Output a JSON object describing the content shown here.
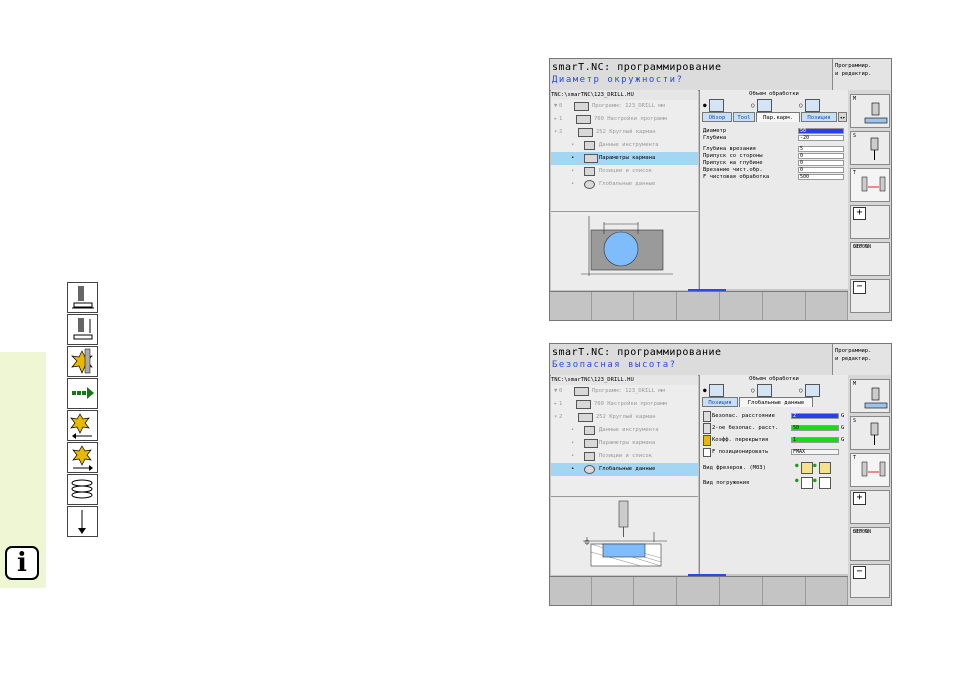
{
  "info_button": {
    "label": "i"
  },
  "left_cycle_icons": [
    "drill-depth-icon",
    "tool-length-icon",
    "rotating-milling-icon",
    "rapid-feed-arrow-icon",
    "milling-cycle-icon",
    "back-milling-icon",
    "helix-icon",
    "straight-arrow-icon"
  ],
  "screen1": {
    "title": "smarT.NC: программирование",
    "subtitle": "Диаметр окружности?",
    "mode": [
      "Программир.",
      "и редактир."
    ],
    "path": "TNC:\\smarTNC\\123_DRILL.HU",
    "tree": [
      {
        "mark": "▼",
        "num": "0",
        "label": "Программ: 123_DRILL мм",
        "selected": false
      },
      {
        "mark": "▸",
        "num": "1",
        "label": "700 Настройки программ",
        "selected": false
      },
      {
        "mark": "▾",
        "num": "2",
        "label": "252 Круглый карман",
        "selected": false
      },
      {
        "mark": "•",
        "num": "",
        "label": "Данные инструмента",
        "selected": false
      },
      {
        "mark": "•",
        "num": "",
        "label": "Параметры кармана",
        "selected": true
      },
      {
        "mark": "•",
        "num": "",
        "label": "Позиции и список",
        "selected": false
      },
      {
        "mark": "•",
        "num": "",
        "label": "Глобальные данные",
        "selected": false
      }
    ],
    "section_title": "Объем обработки",
    "tabs": [
      "Обзор",
      "Tool",
      "Пар.карм.",
      "Позиция"
    ],
    "active_tab": 2,
    "fields": [
      {
        "label": "Диаметр",
        "value": "50",
        "highlight": true
      },
      {
        "label": "Глубина",
        "value": "-20",
        "highlight": false
      },
      {
        "label": "Глубина врезания",
        "value": "5",
        "highlight": false
      },
      {
        "label": "Припуск со стороны",
        "value": "0",
        "highlight": false
      },
      {
        "label": "Припуск на глубине",
        "value": "0",
        "highlight": false
      },
      {
        "label": "Врезание чист.обр.",
        "value": "0",
        "highlight": false
      },
      {
        "label": "F чистовая обработка",
        "value": "500",
        "highlight": false
      }
    ],
    "colors": {
      "highlight": "#2540ee",
      "selected_row": "#a3d6f2",
      "accent": "#2a4be0"
    }
  },
  "screen2": {
    "title": "smarT.NC: программирование",
    "subtitle": "Безопасная высота?",
    "mode": [
      "Программир.",
      "и редактир."
    ],
    "path": "TNC:\\smarTNC\\123_DRILL.HU",
    "tree": [
      {
        "mark": "▼",
        "num": "0",
        "label": "Программ: 123_DRILL мм",
        "selected": false
      },
      {
        "mark": "▸",
        "num": "1",
        "label": "700 Настройки программ",
        "selected": false
      },
      {
        "mark": "▾",
        "num": "2",
        "label": "252 Круглый карман",
        "selected": false
      },
      {
        "mark": "•",
        "num": "",
        "label": "Данные инструмента",
        "selected": false
      },
      {
        "mark": "•",
        "num": "",
        "label": "Параметры кармана",
        "selected": false
      },
      {
        "mark": "•",
        "num": "",
        "label": "Позиции и список",
        "selected": false
      },
      {
        "mark": "•",
        "num": "",
        "label": "Глобальные данные",
        "selected": true
      }
    ],
    "section_title": "Объем обработки",
    "tabs": [
      "Позиция",
      "Глобальные данные"
    ],
    "active_tab": 1,
    "fields": [
      {
        "label": "Безопас. расстояние",
        "value": "2",
        "style": "blue",
        "suffix": "G"
      },
      {
        "label": "2-ое безопас. расст.",
        "value": "50",
        "style": "green",
        "suffix": "G"
      },
      {
        "label": "Коэфф. перекрытия",
        "value": "1",
        "style": "green",
        "suffix": "G"
      },
      {
        "label": "F позиционировать",
        "value": "FMAX",
        "style": "none",
        "suffix": ""
      }
    ],
    "extra_rows": [
      {
        "label": "Вид фрезеров. (M03)"
      },
      {
        "label": "Вид погружения"
      }
    ]
  },
  "sidebar": {
    "buttons": [
      {
        "label": "M",
        "extra": ""
      },
      {
        "label": "S",
        "extra": ""
      },
      {
        "label": "T",
        "extra": ""
      },
      {
        "label": "S",
        "extra": "+"
      },
      {
        "label": "S100%",
        "extra": "OFF ON"
      },
      {
        "label": "S",
        "extra": "−"
      }
    ]
  }
}
